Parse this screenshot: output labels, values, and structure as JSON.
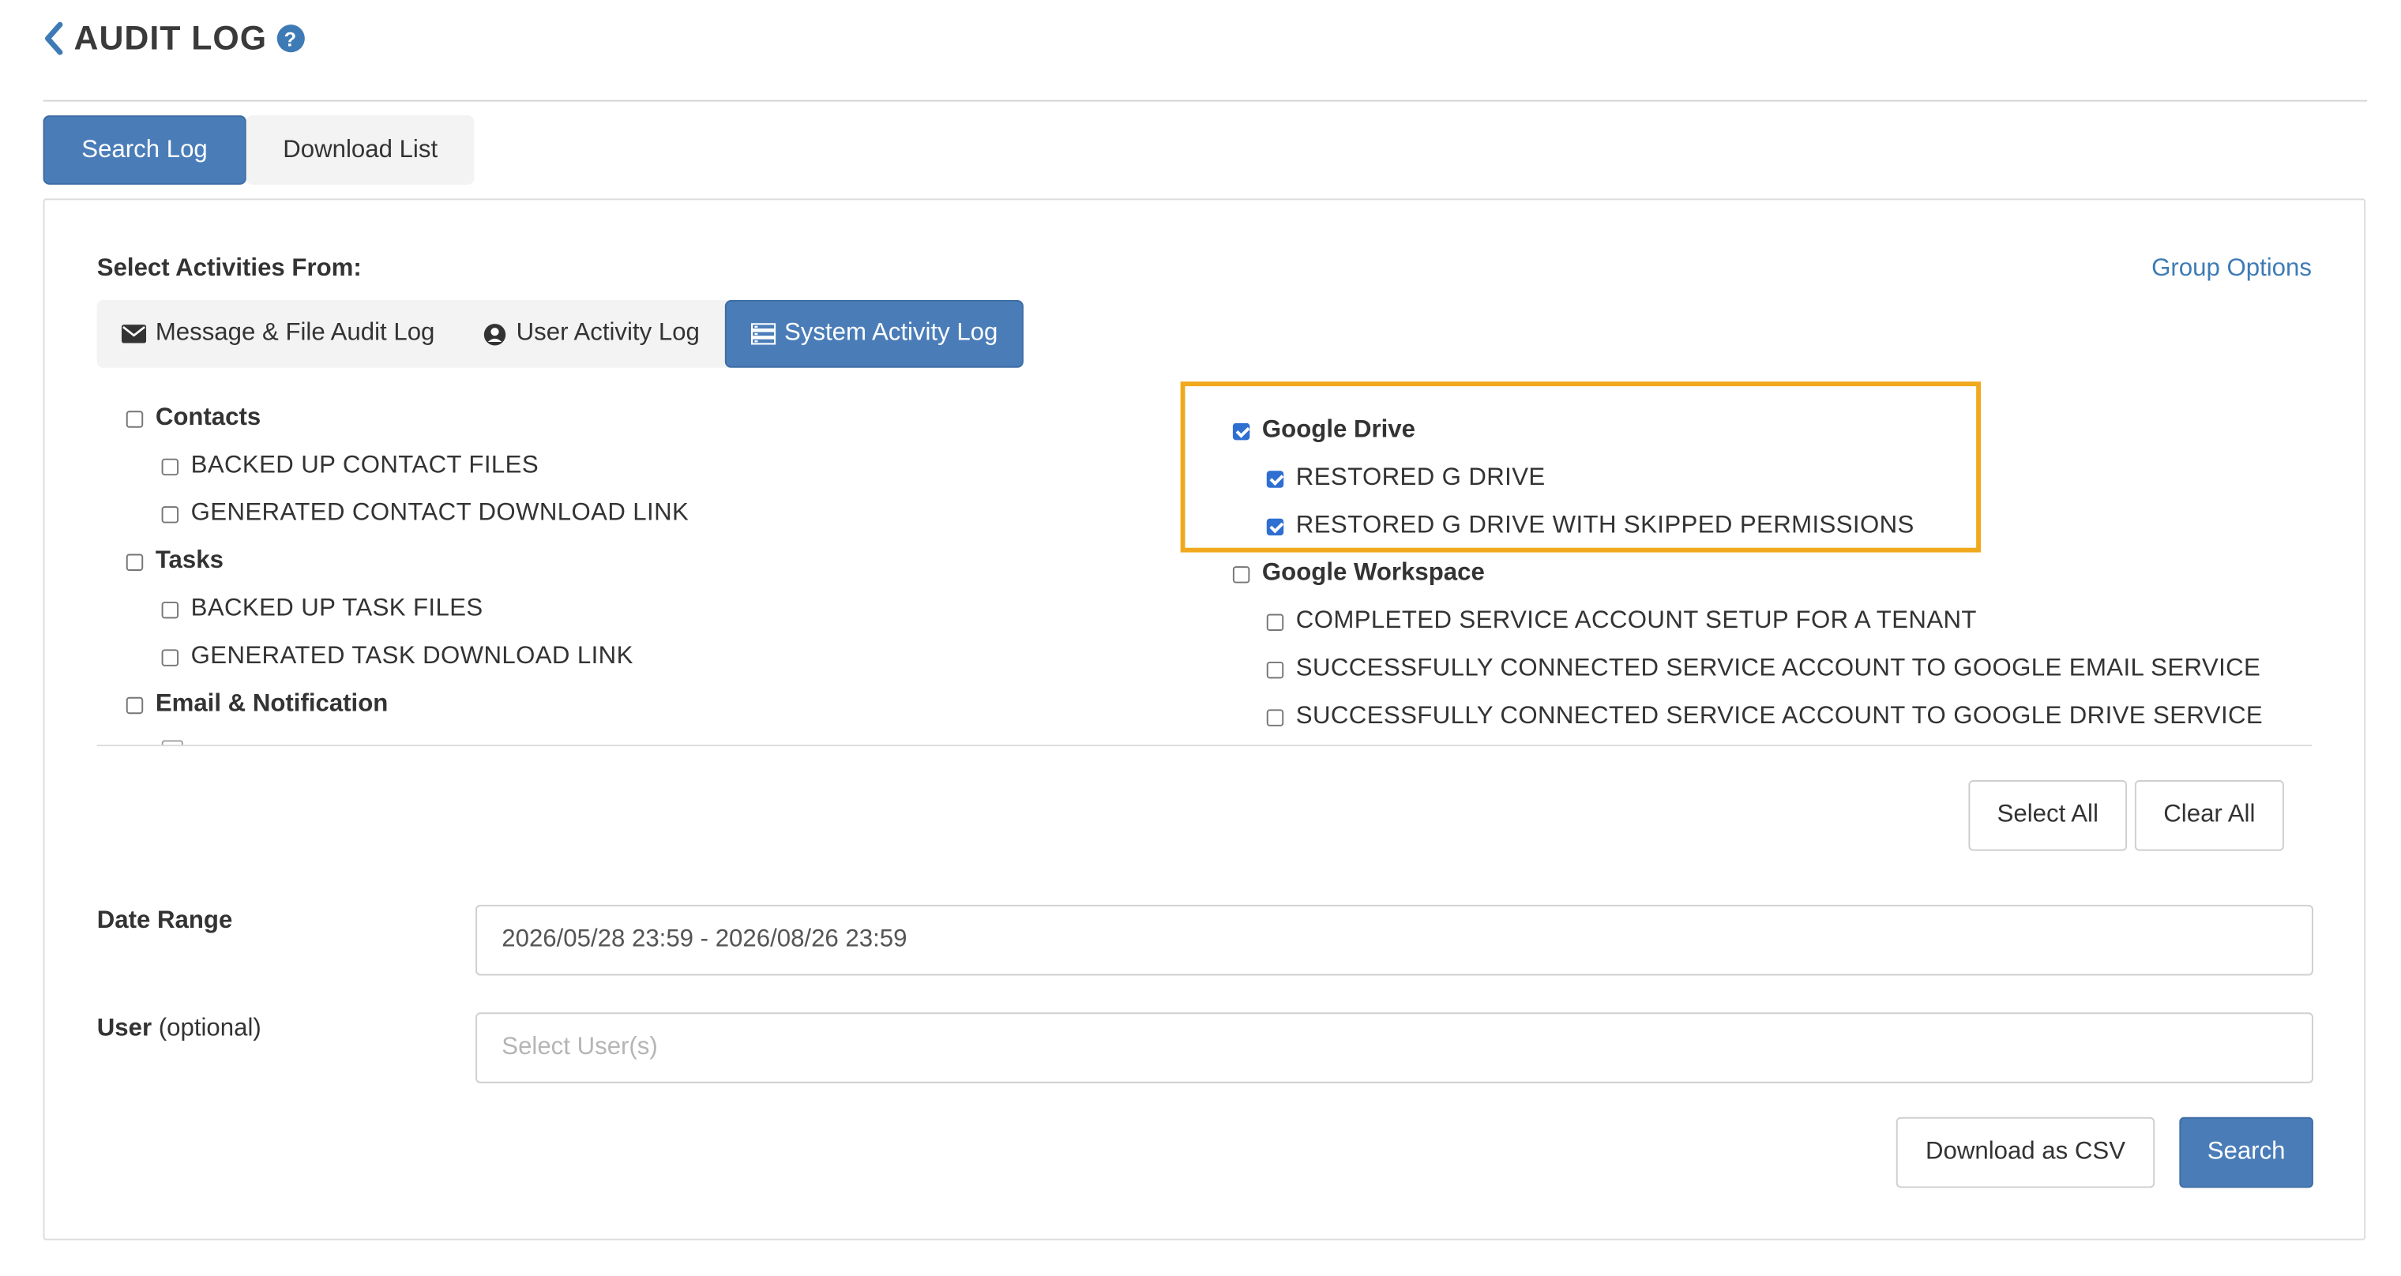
{
  "header": {
    "title": "AUDIT LOG",
    "help_icon": "?"
  },
  "top_tabs": [
    {
      "label": "Search Log",
      "active": true
    },
    {
      "label": "Download List",
      "active": false
    }
  ],
  "select_activities_label": "Select Activities From:",
  "group_options_label": "Group Options",
  "sub_tabs": [
    {
      "label": "Message & File Audit Log",
      "icon": "envelope-icon",
      "active": false
    },
    {
      "label": "User Activity Log",
      "icon": "user-circle-icon",
      "active": false
    },
    {
      "label": "System Activity Log",
      "icon": "server-icon",
      "active": true
    }
  ],
  "left_column": [
    {
      "label": "Contacts",
      "type": "group",
      "checked": false
    },
    {
      "label": "BACKED UP CONTACT FILES",
      "type": "item",
      "checked": false
    },
    {
      "label": "GENERATED CONTACT DOWNLOAD LINK",
      "type": "item",
      "checked": false
    },
    {
      "label": "Tasks",
      "type": "group",
      "checked": false
    },
    {
      "label": "BACKED UP TASK FILES",
      "type": "item",
      "checked": false
    },
    {
      "label": "GENERATED TASK DOWNLOAD LINK",
      "type": "item",
      "checked": false
    },
    {
      "label": "Email & Notification",
      "type": "group",
      "checked": false
    }
  ],
  "right_column": [
    {
      "label": "Google Drive",
      "type": "group",
      "checked": true
    },
    {
      "label": "RESTORED G DRIVE",
      "type": "item",
      "checked": true
    },
    {
      "label": "RESTORED G DRIVE WITH SKIPPED PERMISSIONS",
      "type": "item",
      "checked": true
    },
    {
      "label": "Google Workspace",
      "type": "group",
      "checked": false
    },
    {
      "label": "COMPLETED SERVICE ACCOUNT SETUP FOR A TENANT",
      "type": "item",
      "checked": false
    },
    {
      "label": "SUCCESSFULLY CONNECTED SERVICE ACCOUNT TO GOOGLE EMAIL SERVICE",
      "type": "item",
      "checked": false
    },
    {
      "label": "SUCCESSFULLY CONNECTED SERVICE ACCOUNT TO GOOGLE DRIVE SERVICE",
      "type": "item",
      "checked": false
    }
  ],
  "actions": {
    "select_all": "Select All",
    "clear_all": "Clear All"
  },
  "date_range": {
    "label": "Date Range",
    "value": "2026/05/28 23:59 - 2026/08/26 23:59"
  },
  "user": {
    "label_bold": "User",
    "label_suffix": "(optional)",
    "placeholder": "Select User(s)"
  },
  "footer": {
    "download_csv": "Download as CSV",
    "search": "Search"
  },
  "colors": {
    "primary": "#4a7db8",
    "highlight": "#f0a81c",
    "link": "#3e7bb6"
  }
}
